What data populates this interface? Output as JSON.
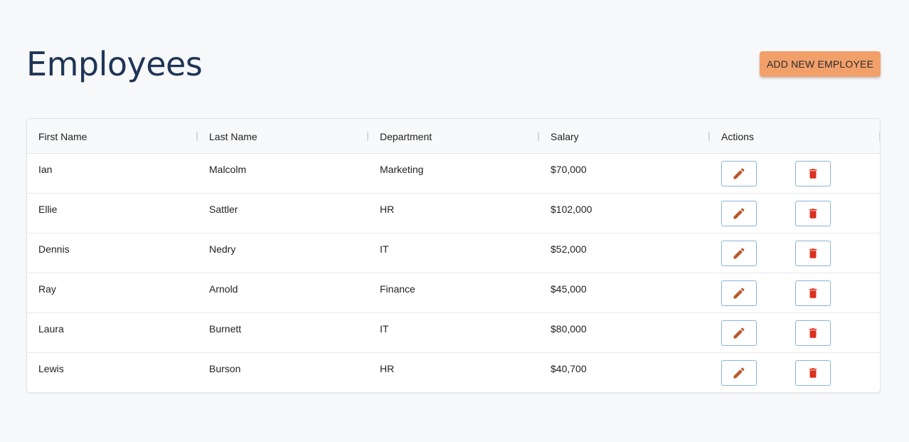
{
  "page": {
    "title": "Employees",
    "add_button_label": "ADD NEW EMPLOYEE"
  },
  "table": {
    "columns": [
      "First Name",
      "Last Name",
      "Department",
      "Salary",
      "Actions"
    ],
    "rows": [
      {
        "first_name": "Ian",
        "last_name": "Malcolm",
        "department": "Marketing",
        "salary": "$70,000"
      },
      {
        "first_name": "Ellie",
        "last_name": "Sattler",
        "department": "HR",
        "salary": "$102,000"
      },
      {
        "first_name": "Dennis",
        "last_name": "Nedry",
        "department": "IT",
        "salary": "$52,000"
      },
      {
        "first_name": "Ray",
        "last_name": "Arnold",
        "department": "Finance",
        "salary": "$45,000"
      },
      {
        "first_name": "Laura",
        "last_name": "Burnett",
        "department": "IT",
        "salary": "$80,000"
      },
      {
        "first_name": "Lewis",
        "last_name": "Burson",
        "department": "HR",
        "salary": "$40,700"
      }
    ],
    "row_actions": {
      "edit_icon": "pencil-icon",
      "delete_icon": "trash-icon"
    }
  },
  "colors": {
    "title": "#1f3556",
    "add_button_bg": "#f2a06a",
    "edit_icon": "#b8582a",
    "delete_icon": "#d9321f",
    "action_button_border": "#8ab4d6"
  }
}
